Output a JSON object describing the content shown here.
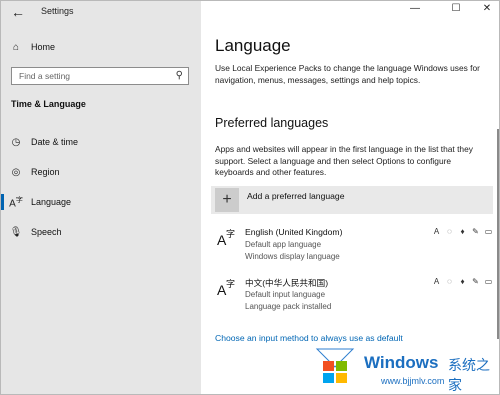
{
  "window": {
    "title": "Settings",
    "controls": [
      "—",
      "☐",
      "✕"
    ]
  },
  "sidebar": {
    "home_label": "Home",
    "search_placeholder": "Find a setting",
    "section_title": "Time & Language",
    "items": [
      {
        "label": "Date & time",
        "icon": "clock-icon"
      },
      {
        "label": "Region",
        "icon": "globe-icon"
      },
      {
        "label": "Language",
        "icon": "language-icon",
        "selected": true
      },
      {
        "label": "Speech",
        "icon": "microphone-icon"
      }
    ]
  },
  "main": {
    "title": "Language",
    "description": "Use Local Experience Packs to change the language Windows uses for navigation, menus, messages, settings and help topics.",
    "preferred_title": "Preferred languages",
    "preferred_description": "Apps and websites will appear in the first language in the list that they support. Select a language and then select Options to configure keyboards and other features.",
    "add_label": "Add a preferred language",
    "languages": [
      {
        "name": "English (United Kingdom)",
        "sub1": "Default app language",
        "sub2": "Windows display language"
      },
      {
        "name": "中文(中华人民共和国)",
        "sub1": "Default input language",
        "sub2": "Language pack installed"
      }
    ],
    "link": "Choose an input method to always use as default"
  },
  "watermark": {
    "brand": "Windows",
    "cn": "系统之家",
    "url": "www.bjjmlv.com"
  },
  "colors": {
    "accent": "#0063b1",
    "link": "#0066b4",
    "sidebar_bg": "#e6e6e6"
  }
}
